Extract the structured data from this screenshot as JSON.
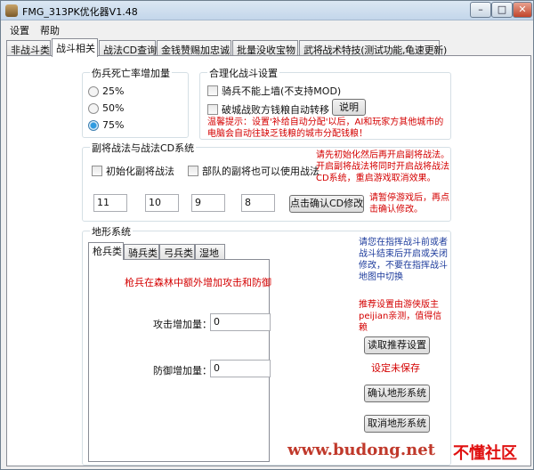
{
  "window": {
    "title": "FMG_313PK优化器V1.48",
    "minimize": "–",
    "maximize": "□",
    "close": "✕"
  },
  "menu": [
    "设置",
    "帮助"
  ],
  "tabs": [
    "非战斗类",
    "战斗相关",
    "战法CD查询",
    "金钱赞赐加忠诚",
    "批量没收宝物",
    "武将战术特技(测试功能,龟速更新)"
  ],
  "casualty": {
    "title": "伤兵死亡率增加量",
    "options": [
      "25%",
      "50%",
      "75%"
    ],
    "selected": "75%"
  },
  "battle": {
    "title": "合理化战斗设置",
    "check1": "骑兵不能上墙(不支持MOD)",
    "check2": "破城战败方钱粮自动转移",
    "explain_button": "说明",
    "tip": "温馨提示：设置'补给自动分配'以后，AI和玩家方其他城市的电脑会自动往缺乏钱粮的城市分配钱粮！"
  },
  "cd": {
    "title": "副将战法与战法CD系统",
    "check1": "初始化副将战法",
    "check2": "部队的副将也可以使用战法",
    "note1": "请先初始化然后再开启副将战法。开启副将战法将同时开启战将战法CD系统，重启游戏取消效果。",
    "values": [
      "11",
      "10",
      "9",
      "8"
    ],
    "confirm_button": "点击确认CD修改",
    "note2": "请暂停游戏后，再点击确认修改。"
  },
  "terrain": {
    "title": "地形系统",
    "subtabs": [
      "枪兵类",
      "骑兵类",
      "弓兵类",
      "湿地"
    ],
    "desc": "枪兵在森林中额外增加攻击和防御",
    "attack_label": "攻击增加量：",
    "attack_value": "0",
    "defense_label": "防御增加量：",
    "defense_value": "0",
    "note_blue": "请您在指挥战斗前或者战斗结束后开启或关闭修改，不要在指挥战斗地图中切换",
    "note_red": "推荐设置由游侠版主peijian亲测，值得信赖",
    "read_button": "读取推荐设置",
    "unsaved": "设定未保存",
    "confirm_button": "确认地形系统",
    "cancel_button": "取消地形系统"
  },
  "watermark": {
    "site": "www.budong.net",
    "brand": "不懂社区"
  }
}
